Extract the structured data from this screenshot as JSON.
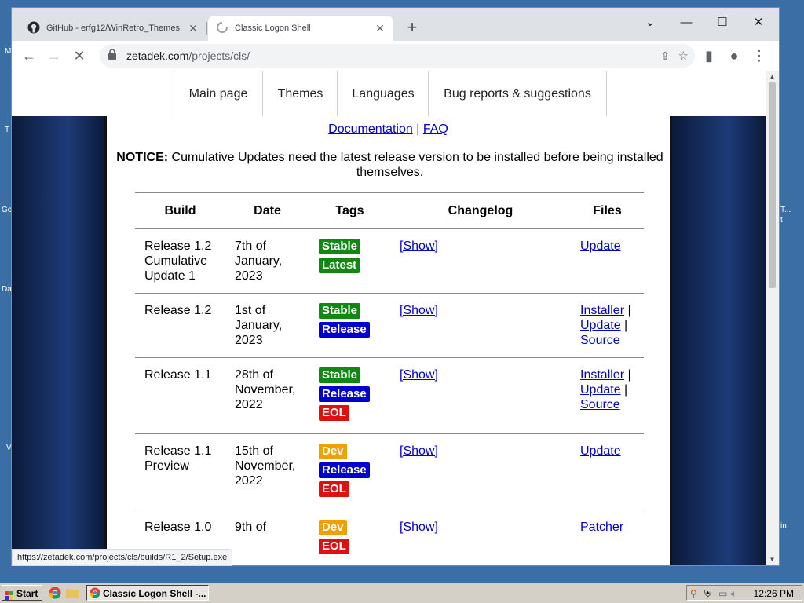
{
  "desktop": {
    "side_labels": [
      "M",
      "T",
      "Go",
      "Da",
      "V",
      "T...",
      "t",
      "in"
    ]
  },
  "browser": {
    "tabs": [
      {
        "title": "GitHub - erfg12/WinRetro_Themes:",
        "active": false
      },
      {
        "title": "Classic Logon Shell",
        "active": true
      }
    ],
    "url_host": "zetadek.com",
    "url_path": "/projects/cls/",
    "status_url": "https://zetadek.com/projects/cls/builds/R1_2/Setup.exe"
  },
  "nav": [
    "Main page",
    "Themes",
    "Languages",
    "Bug reports & suggestions"
  ],
  "page": {
    "doc_link": "Documentation",
    "separator": "|",
    "faq_link": "FAQ",
    "notice_label": "NOTICE:",
    "notice_text": " Cumulative Updates need the latest release version to be installed before being installed themselves.",
    "table_headers": [
      "Build",
      "Date",
      "Tags",
      "Changelog",
      "Files"
    ],
    "show_label": "[Show]",
    "rows": [
      {
        "build": "Release 1.2 Cumulative Update 1",
        "date": "7th of January, 2023",
        "tags": [
          "Stable",
          "Latest"
        ],
        "files": [
          "Update"
        ]
      },
      {
        "build": "Release 1.2",
        "date": "1st of January, 2023",
        "tags": [
          "Stable",
          "Release"
        ],
        "files": [
          "Installer",
          "Update",
          "Source"
        ]
      },
      {
        "build": "Release 1.1",
        "date": "28th of November, 2022",
        "tags": [
          "Stable",
          "Release",
          "EOL"
        ],
        "files": [
          "Installer",
          "Update",
          "Source"
        ]
      },
      {
        "build": "Release 1.1 Preview",
        "date": "15th of November, 2022",
        "tags": [
          "Dev",
          "Release",
          "EOL"
        ],
        "files": [
          "Update"
        ]
      },
      {
        "build": "Release 1.0",
        "date": "9th of",
        "tags": [
          "Dev",
          "EOL"
        ],
        "files": [
          "Patcher"
        ]
      }
    ]
  },
  "tag_colors": {
    "Stable": "#118811",
    "Latest": "#118811",
    "Release": "#0000cc",
    "EOL": "#dd1111",
    "Dev": "#f0a000"
  },
  "taskbar": {
    "start_label": "Start",
    "task_label": "Classic Logon Shell -...",
    "clock": "12:26 PM"
  }
}
